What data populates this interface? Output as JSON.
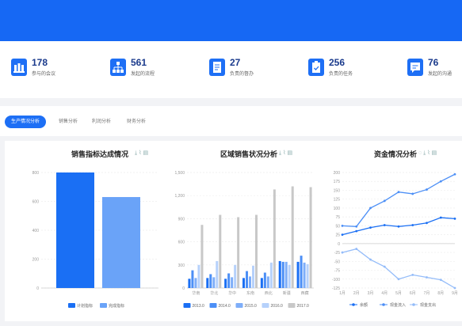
{
  "stats": [
    {
      "value": "178",
      "label": "参与的会议",
      "icon": "meeting-icon"
    },
    {
      "value": "561",
      "label": "发起的流程",
      "icon": "flow-icon"
    },
    {
      "value": "27",
      "label": "负责的督办",
      "icon": "document-icon"
    },
    {
      "value": "256",
      "label": "负责的任务",
      "icon": "clipboard-icon"
    },
    {
      "value": "76",
      "label": "发起的沟通",
      "icon": "chat-icon"
    }
  ],
  "tabs": [
    {
      "label": "生产情况分析",
      "active": true
    },
    {
      "label": "销售分析",
      "active": false
    },
    {
      "label": "利润分析",
      "active": false
    },
    {
      "label": "财务分析",
      "active": false
    }
  ],
  "colors": {
    "brand": "#1668f4",
    "accent": "#1d6ff5"
  },
  "chart_data": [
    {
      "type": "bar",
      "title": "销售指标达成情况",
      "categories": [
        ""
      ],
      "series": [
        {
          "name": "计划指标",
          "values": [
            800
          ],
          "color": "#1a6ff4"
        },
        {
          "name": "完成指标",
          "values": [
            630
          ],
          "color": "#6aa3f8"
        }
      ],
      "ylim": [
        0,
        800
      ],
      "yticks": [
        "0",
        "200",
        "400",
        "600",
        "800"
      ],
      "legend": "bottom",
      "grid": true
    },
    {
      "type": "bar",
      "title": "区域销售状况分析",
      "categories": [
        "华南",
        "华北",
        "华中",
        "东南",
        "西北",
        "新疆",
        "西藏"
      ],
      "series": [
        {
          "name": "2013.0",
          "values": [
            120,
            130,
            120,
            130,
            130,
            350,
            340
          ],
          "color": "#1a6ff4"
        },
        {
          "name": "2014.0",
          "values": [
            230,
            180,
            190,
            220,
            200,
            340,
            420
          ],
          "color": "#4c8ff6"
        },
        {
          "name": "2015.0",
          "values": [
            130,
            140,
            140,
            150,
            150,
            340,
            330
          ],
          "color": "#7eaef9"
        },
        {
          "name": "2016.0",
          "values": [
            300,
            350,
            300,
            290,
            330,
            300,
            310
          ],
          "color": "#b6d1fb"
        },
        {
          "name": "2017.0",
          "values": [
            820,
            950,
            920,
            950,
            1280,
            1320,
            1310
          ],
          "color": "#c8c8c8"
        }
      ],
      "ylim": [
        0,
        1500
      ],
      "yticks": [
        "0",
        "300",
        "600",
        "900",
        "1,200",
        "1,500"
      ],
      "legend": "bottom",
      "grid": true
    },
    {
      "type": "line",
      "title": "资金情况分析",
      "categories": [
        "1月",
        "2月",
        "3月",
        "4月",
        "5月",
        "6月",
        "7月",
        "8月",
        "9月"
      ],
      "series": [
        {
          "name": "余额",
          "values": [
            25,
            35,
            45,
            52,
            48,
            52,
            58,
            73,
            70
          ],
          "color": "#1a6ff4"
        },
        {
          "name": "现金流入",
          "values": [
            50,
            48,
            100,
            120,
            145,
            140,
            152,
            175,
            195
          ],
          "color": "#4c8ff6"
        },
        {
          "name": "现金支出",
          "values": [
            -25,
            -15,
            -45,
            -65,
            -100,
            -88,
            -95,
            -102,
            -125
          ],
          "color": "#94bcf9"
        }
      ],
      "ylim": [
        -125,
        200
      ],
      "yticks": [
        "-125",
        "-100",
        "-75",
        "-50",
        "-25",
        "0",
        "25",
        "50",
        "75",
        "100",
        "125",
        "150",
        "175",
        "200"
      ],
      "legend": "bottom",
      "grid": true
    }
  ]
}
